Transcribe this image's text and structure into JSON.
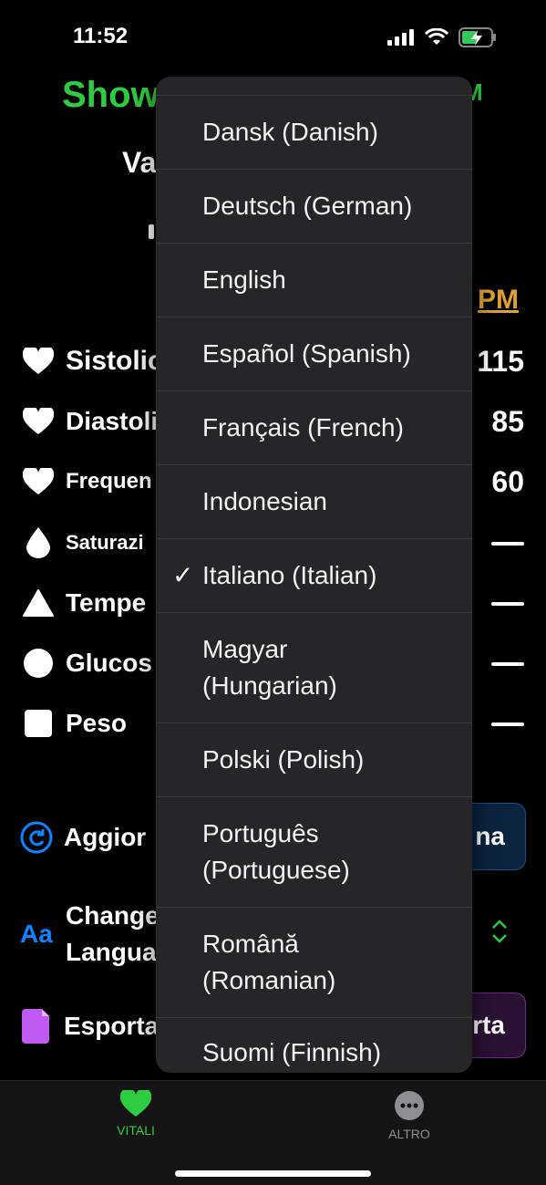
{
  "status": {
    "time": "11:52"
  },
  "header": {
    "title": "Show",
    "title_right": "M",
    "subtitle": "Va",
    "time_link": "PM"
  },
  "vitals": [
    {
      "label": "Sistolic",
      "value": "115",
      "icon": "heart-icon"
    },
    {
      "label": "Diastoli",
      "value": "85",
      "icon": "heart-icon"
    },
    {
      "label": "Frequen",
      "value": "60",
      "icon": "heart-icon"
    },
    {
      "label": "Saturazi",
      "value": "",
      "icon": "drop-icon"
    },
    {
      "label": "Tempe",
      "value": "",
      "icon": "triangle-icon"
    },
    {
      "label": "Glucos",
      "value": "",
      "icon": "circle-icon"
    },
    {
      "label": "Peso",
      "value": "",
      "icon": "square-icon"
    }
  ],
  "actions": {
    "update": {
      "label": "Aggior",
      "button": "na",
      "color": "#0a84ff"
    },
    "language": {
      "label_line1": "Change",
      "label_line2": "Langua",
      "icon_text": "Aa"
    },
    "export": {
      "label": "Esporta",
      "button": "rta",
      "color": "#bf5af2"
    }
  },
  "menu": {
    "items": [
      {
        "label": "Dansk (Danish)",
        "checked": false
      },
      {
        "label": "Deutsch (German)",
        "checked": false
      },
      {
        "label": "English",
        "checked": false
      },
      {
        "label": "Español (Spanish)",
        "checked": false
      },
      {
        "label": "Français (French)",
        "checked": false
      },
      {
        "label": "Indonesian",
        "checked": false
      },
      {
        "label": "Italiano (Italian)",
        "checked": true
      },
      {
        "label": "Magyar (Hungarian)",
        "line1": "Magyar",
        "line2": "(Hungarian)",
        "checked": false
      },
      {
        "label": "Polski (Polish)",
        "checked": false
      },
      {
        "label": "Português (Portuguese)",
        "line1": "Português",
        "line2": "(Portuguese)",
        "checked": false
      },
      {
        "label": "Română (Romanian)",
        "line1": "Română",
        "line2": "(Romanian)",
        "checked": false
      },
      {
        "label": "Suomi (Finnish)",
        "checked": false
      }
    ],
    "checkmark": "✓"
  },
  "tabbar": {
    "tabs": [
      {
        "label": "VITALI",
        "active": true,
        "color": "#2ecc40"
      },
      {
        "label": "ALTRO",
        "active": false,
        "color": "#8e8e93"
      }
    ]
  }
}
